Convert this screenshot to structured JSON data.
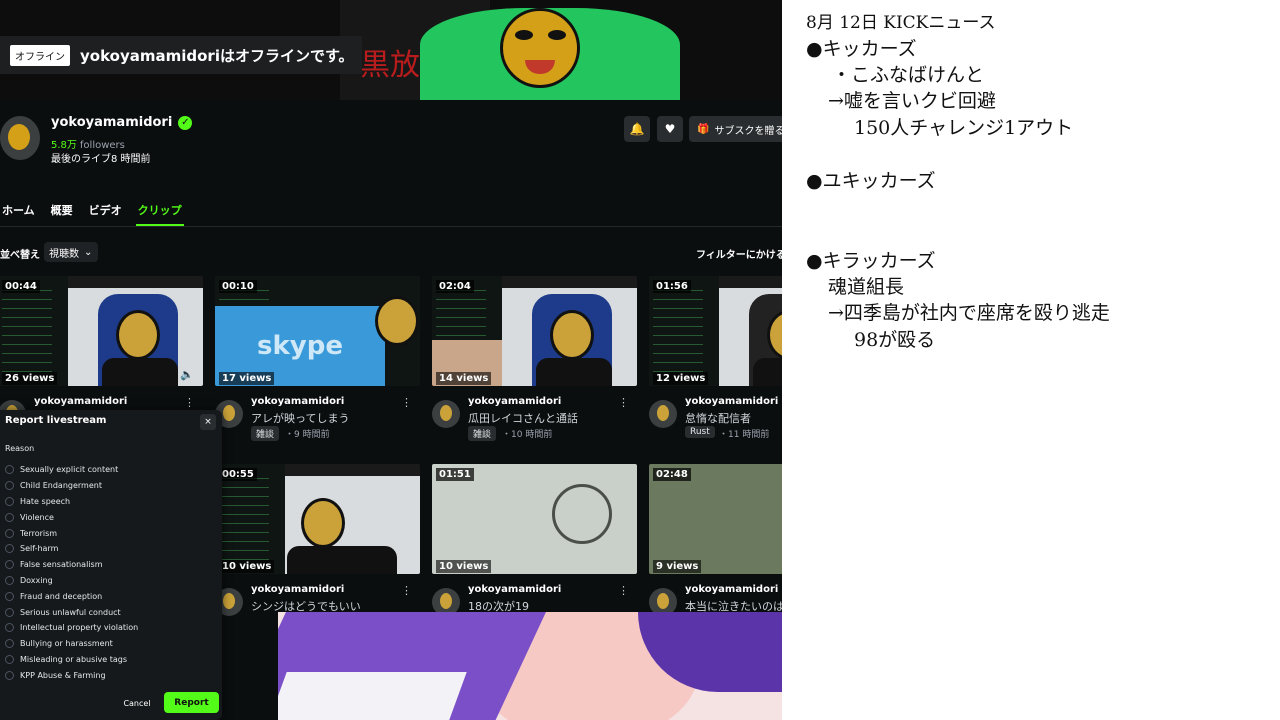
{
  "offline": {
    "badge": "オフライン",
    "message": "yokoyamamidoriはオフラインです。"
  },
  "banner": {
    "art_text": "黒放送"
  },
  "channel": {
    "name": "yokoyamamidori",
    "followers_count": "5.8万",
    "followers_label": "followers",
    "last_live": "最後のライブ8 時間前",
    "verified_icon": "check-icon",
    "subscribe_label": "サブスクを贈る",
    "accent": "#53fc18"
  },
  "tabs": [
    {
      "label": "ホーム",
      "active": false
    },
    {
      "label": "概要",
      "active": false
    },
    {
      "label": "ビデオ",
      "active": false
    },
    {
      "label": "クリップ",
      "active": true
    }
  ],
  "sort": {
    "label": "並べ替え",
    "value": "視聴数",
    "filter_label": "フィルターにかける"
  },
  "clips": [
    {
      "duration": "00:44",
      "views": "26 views",
      "channel": "yokoyamamidori",
      "title": "",
      "tag": "",
      "age": ""
    },
    {
      "duration": "00:10",
      "views": "17 views",
      "channel": "yokoyamamidori",
      "title": "アレが映ってしまう",
      "tag": "雑談",
      "age": "・9 時間前"
    },
    {
      "duration": "02:04",
      "views": "14 views",
      "channel": "yokoyamamidori",
      "title": "瓜田レイコさんと通話",
      "tag": "雑談",
      "age": "・10 時間前"
    },
    {
      "duration": "01:56",
      "views": "12 views",
      "channel": "yokoyamamidori",
      "title": "怠惰な配信者",
      "tag": "Rust",
      "age": "・11 時間前"
    },
    {
      "duration": "00:55",
      "views": "10 views",
      "channel": "yokoyamamidori",
      "title": "シンジはどうでもいい",
      "tag": "",
      "age": ""
    },
    {
      "duration": "01:51",
      "views": "10 views",
      "channel": "yokoyamamidori",
      "title": "18の次が19",
      "tag": "",
      "age": ""
    },
    {
      "duration": "02:48",
      "views": "9 views",
      "channel": "yokoyamamidori",
      "title": "本当に泣きたいのは",
      "tag": "",
      "age": ""
    }
  ],
  "report": {
    "title": "Report livestream",
    "close": "×",
    "reason_label": "Reason",
    "reasons": [
      "Sexually explicit content",
      "Child Endangerment",
      "Hate speech",
      "Violence",
      "Terrorism",
      "Self-harm",
      "False sensationalism",
      "Doxxing",
      "Fraud and deception",
      "Serious unlawful conduct",
      "Intellectual property violation",
      "Bullying or harassment",
      "Misleading or abusive tags",
      "KPP Abuse & Farming"
    ],
    "cancel": "Cancel",
    "submit": "Report"
  },
  "notes": {
    "date": "8月 12日 KICKニュース",
    "lines": [
      "●キッカーズ",
      "・こふなばけんと",
      "→嘘を言いクビ回避",
      "150人チャレンジ1アウト",
      "●ユキッカーズ",
      "●キラッカーズ",
      "魂道組長",
      "→四季島が社内で座席を殴り逃走",
      "98が殴る"
    ]
  }
}
